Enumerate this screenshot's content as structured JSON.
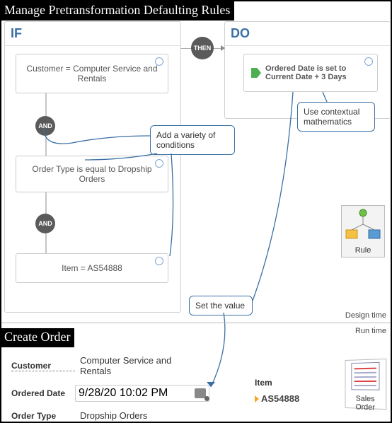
{
  "page_title": "Manage Pretransformation Defaulting Rules",
  "if": {
    "title": "IF",
    "blocks": [
      "Customer = Computer Service and Rentals",
      "Order Type is equal to Dropship Orders",
      "Item = AS54888"
    ],
    "connector": "AND"
  },
  "then_label": "THEN",
  "do": {
    "title": "DO",
    "action": "Ordered Date is set to Current Date + 3 Days"
  },
  "callouts": {
    "conditions": "Add a variety of conditions",
    "math": "Use contextual mathematics",
    "set_value": "Set the value"
  },
  "time_labels": {
    "design": "Design time",
    "run": "Run time"
  },
  "order_form": {
    "title": "Create Order",
    "customer": {
      "label": "Customer",
      "value": "Computer Service and Rentals"
    },
    "ordered_date": {
      "label": "Ordered Date",
      "value": "9/28/20 10:02 PM"
    },
    "order_type": {
      "label": "Order Type",
      "value": "Dropship Orders"
    },
    "item": {
      "label": "Item",
      "value": "AS54888"
    }
  },
  "cards": {
    "rule": "Rule",
    "sales_order": "Sales Order"
  }
}
